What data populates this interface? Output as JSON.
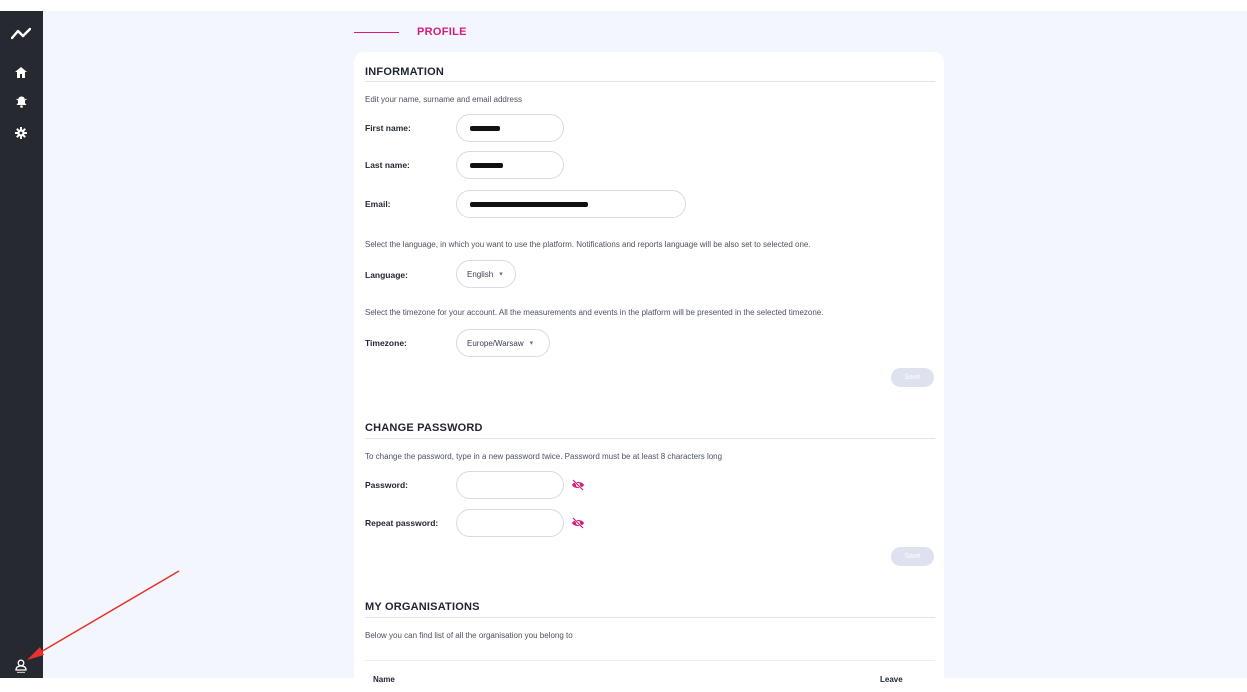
{
  "sidebar": {
    "items": [
      {
        "icon": "activity-icon"
      },
      {
        "icon": "home-icon"
      },
      {
        "icon": "bell-icon"
      },
      {
        "icon": "gear-icon"
      },
      {
        "icon": "user-icon"
      }
    ]
  },
  "profile": {
    "section_title": "PROFILE"
  },
  "information": {
    "title": "INFORMATION",
    "help": "Edit your name, surname and email address",
    "first_name_label": "First name:",
    "last_name_label": "Last name:",
    "email_label": "Email:",
    "language_help": "Select the language, in which you want to use the platform. Notifications and reports language will be also set to selected one.",
    "language_label": "Language:",
    "language_value": "English",
    "timezone_help": "Select the timezone for your account. All the measurements and events in the platform will be presented in the selected timezone.",
    "timezone_label": "Timezone:",
    "timezone_value": "Europe/Warsaw",
    "save_label": "Save"
  },
  "change_password": {
    "title": "CHANGE PASSWORD",
    "help": "To change the password, type in a new password twice. Password must be at least 8 characters long",
    "password_label": "Password:",
    "repeat_label": "Repeat password:",
    "save_label": "Save"
  },
  "organisations": {
    "title": "MY ORGANISATIONS",
    "help": "Below you can find list of all the organisation you belong to",
    "columns": [
      "Name",
      "Leave"
    ]
  },
  "colors": {
    "accent": "#d81b78",
    "sidebar": "#262a30",
    "page_bg": "#f3f6fc",
    "annotation_arrow": "#e8322b"
  }
}
